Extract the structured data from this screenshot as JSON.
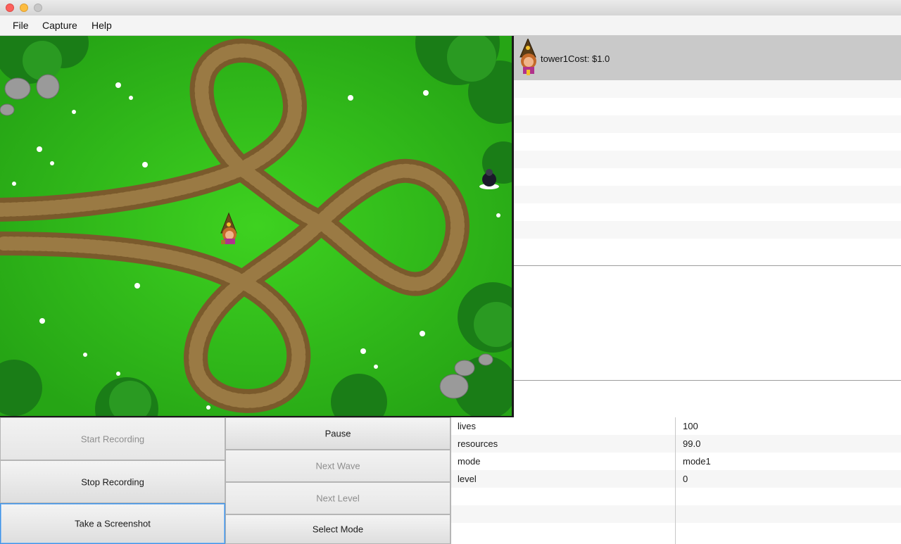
{
  "window": {
    "controls": [
      "close",
      "minimize",
      "maximize"
    ]
  },
  "menu": {
    "items": [
      "File",
      "Capture",
      "Help"
    ]
  },
  "map": {
    "description_icon": "tower-sprite"
  },
  "tower_store": {
    "items": [
      {
        "label": "tower1Cost: $1.0",
        "icon": "wizard-monkey-tower-icon"
      }
    ]
  },
  "controls": {
    "start_recording": "Start Recording",
    "stop_recording": "Stop Recording",
    "take_screenshot": "Take a Screenshot",
    "pause": "Pause",
    "next_wave": "Next Wave",
    "next_level": "Next Level",
    "select_mode": "Select Mode"
  },
  "stats": {
    "rows": [
      {
        "key": "lives",
        "value": "100"
      },
      {
        "key": "resources",
        "value": "99.0"
      },
      {
        "key": "mode",
        "value": "mode1"
      },
      {
        "key": "level",
        "value": "0"
      }
    ]
  },
  "colors": {
    "grass": "#2fc11a",
    "path": "#8a6a35",
    "selection": "#c9c9c9",
    "focus": "#3f93e6"
  }
}
